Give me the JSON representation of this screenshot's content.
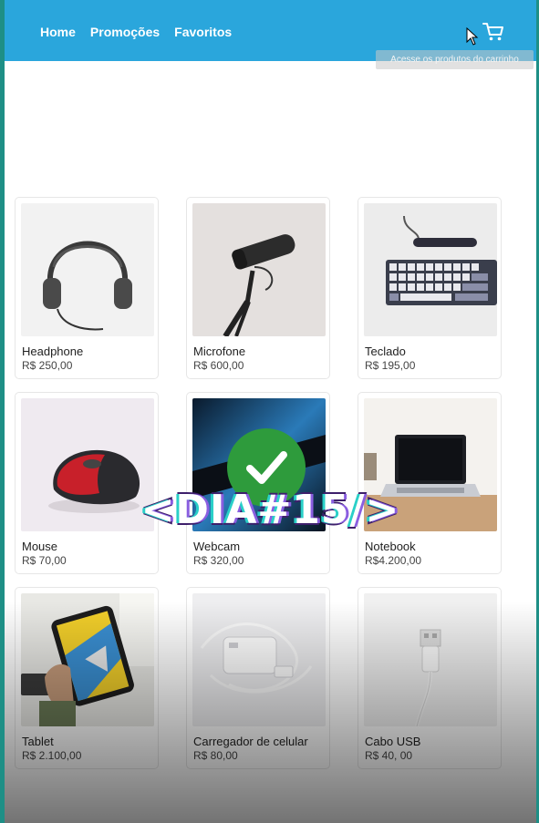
{
  "nav": {
    "items": [
      "Home",
      "Promoções",
      "Favoritos"
    ]
  },
  "cart": {
    "icon": "cart-icon",
    "tooltip": "Acesse os produtos do carrinho"
  },
  "products": [
    {
      "name": "Headphone",
      "price": "R$ 250,00",
      "icon": "headphone"
    },
    {
      "name": "Microfone",
      "price": "R$ 600,00",
      "icon": "microphone"
    },
    {
      "name": "Teclado",
      "price": "R$ 195,00",
      "icon": "keyboard"
    },
    {
      "name": "Mouse",
      "price": "R$ 70,00",
      "icon": "mouse"
    },
    {
      "name": "Webcam",
      "price": "R$ 320,00",
      "icon": "webcam"
    },
    {
      "name": "Notebook",
      "price": "R$4.200,00",
      "icon": "notebook"
    },
    {
      "name": "Tablet",
      "price": "R$ 2.100,00",
      "icon": "tablet"
    },
    {
      "name": "Carregador de celular",
      "price": "R$ 80,00",
      "icon": "charger"
    },
    {
      "name": "Cabo USB",
      "price": "R$ 40, 00",
      "icon": "usb-cable"
    }
  ],
  "overlay": {
    "text": "<DIA#15/>",
    "badge_icon": "checkmark-icon",
    "badge_color": "#2e9b3c"
  },
  "colors": {
    "header": "#2aa6dc",
    "frame_border": "#1e8f86"
  }
}
